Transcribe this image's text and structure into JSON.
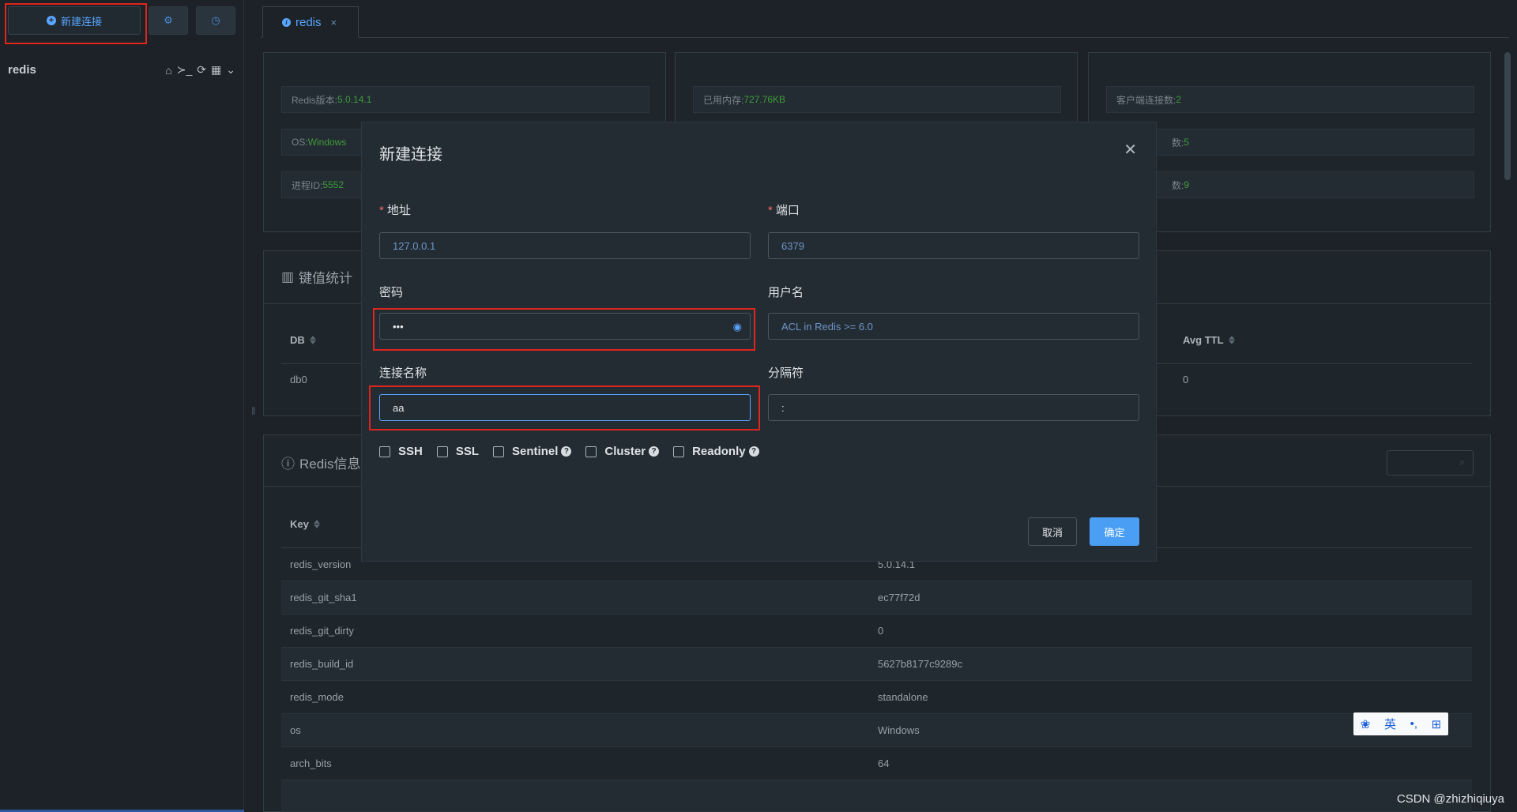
{
  "sidebar": {
    "new_connection": "新建连接",
    "connection_name": "redis"
  },
  "tab": {
    "label": "redis",
    "close": "×"
  },
  "server_info": {
    "col1": [
      {
        "label": "Redis版本: ",
        "value": "5.0.14.1"
      },
      {
        "label": "OS: ",
        "value": "Windows"
      },
      {
        "label": "进程ID: ",
        "value": "5552"
      }
    ],
    "col2": [
      {
        "label": "已用内存: ",
        "value": "727.76KB"
      }
    ],
    "col3": [
      {
        "label": "客户端连接数: ",
        "value": "2"
      },
      {
        "label": "数: ",
        "value": "5"
      },
      {
        "label": "数: ",
        "value": "9"
      }
    ]
  },
  "key_stats": {
    "title": "键值统计",
    "col_db": "DB",
    "col_avg_ttl": "Avg TTL",
    "row_db": "db0",
    "row_avg_ttl": "0"
  },
  "redis_info": {
    "title": "Redis信息",
    "col_key": "Key",
    "rows": [
      {
        "k": "redis_version",
        "v": "5.0.14.1"
      },
      {
        "k": "redis_git_sha1",
        "v": "ec77f72d"
      },
      {
        "k": "redis_git_dirty",
        "v": "0"
      },
      {
        "k": "redis_build_id",
        "v": "5627b8177c9289c"
      },
      {
        "k": "redis_mode",
        "v": "standalone"
      },
      {
        "k": "os",
        "v": "Windows"
      },
      {
        "k": "arch_bits",
        "v": "64"
      }
    ]
  },
  "dialog": {
    "title": "新建连接",
    "address_label": "地址",
    "address_placeholder": "127.0.0.1",
    "port_label": "端口",
    "port_placeholder": "6379",
    "password_label": "密码",
    "password_value": "•••",
    "username_label": "用户名",
    "username_placeholder": "ACL in Redis >= 6.0",
    "conn_name_label": "连接名称",
    "conn_name_value": "aa",
    "separator_label": "分隔符",
    "separator_value": ":",
    "checks": [
      "SSH",
      "SSL",
      "Sentinel",
      "Cluster",
      "Readonly"
    ],
    "cancel": "取消",
    "ok": "确定"
  },
  "ime": {
    "lang": "英"
  },
  "watermark": "CSDN @zhizhiqiuya",
  "colors": {
    "accent": "#4a9ff5",
    "highlight": "#e0241e",
    "value_green": "#3f9a3a"
  }
}
